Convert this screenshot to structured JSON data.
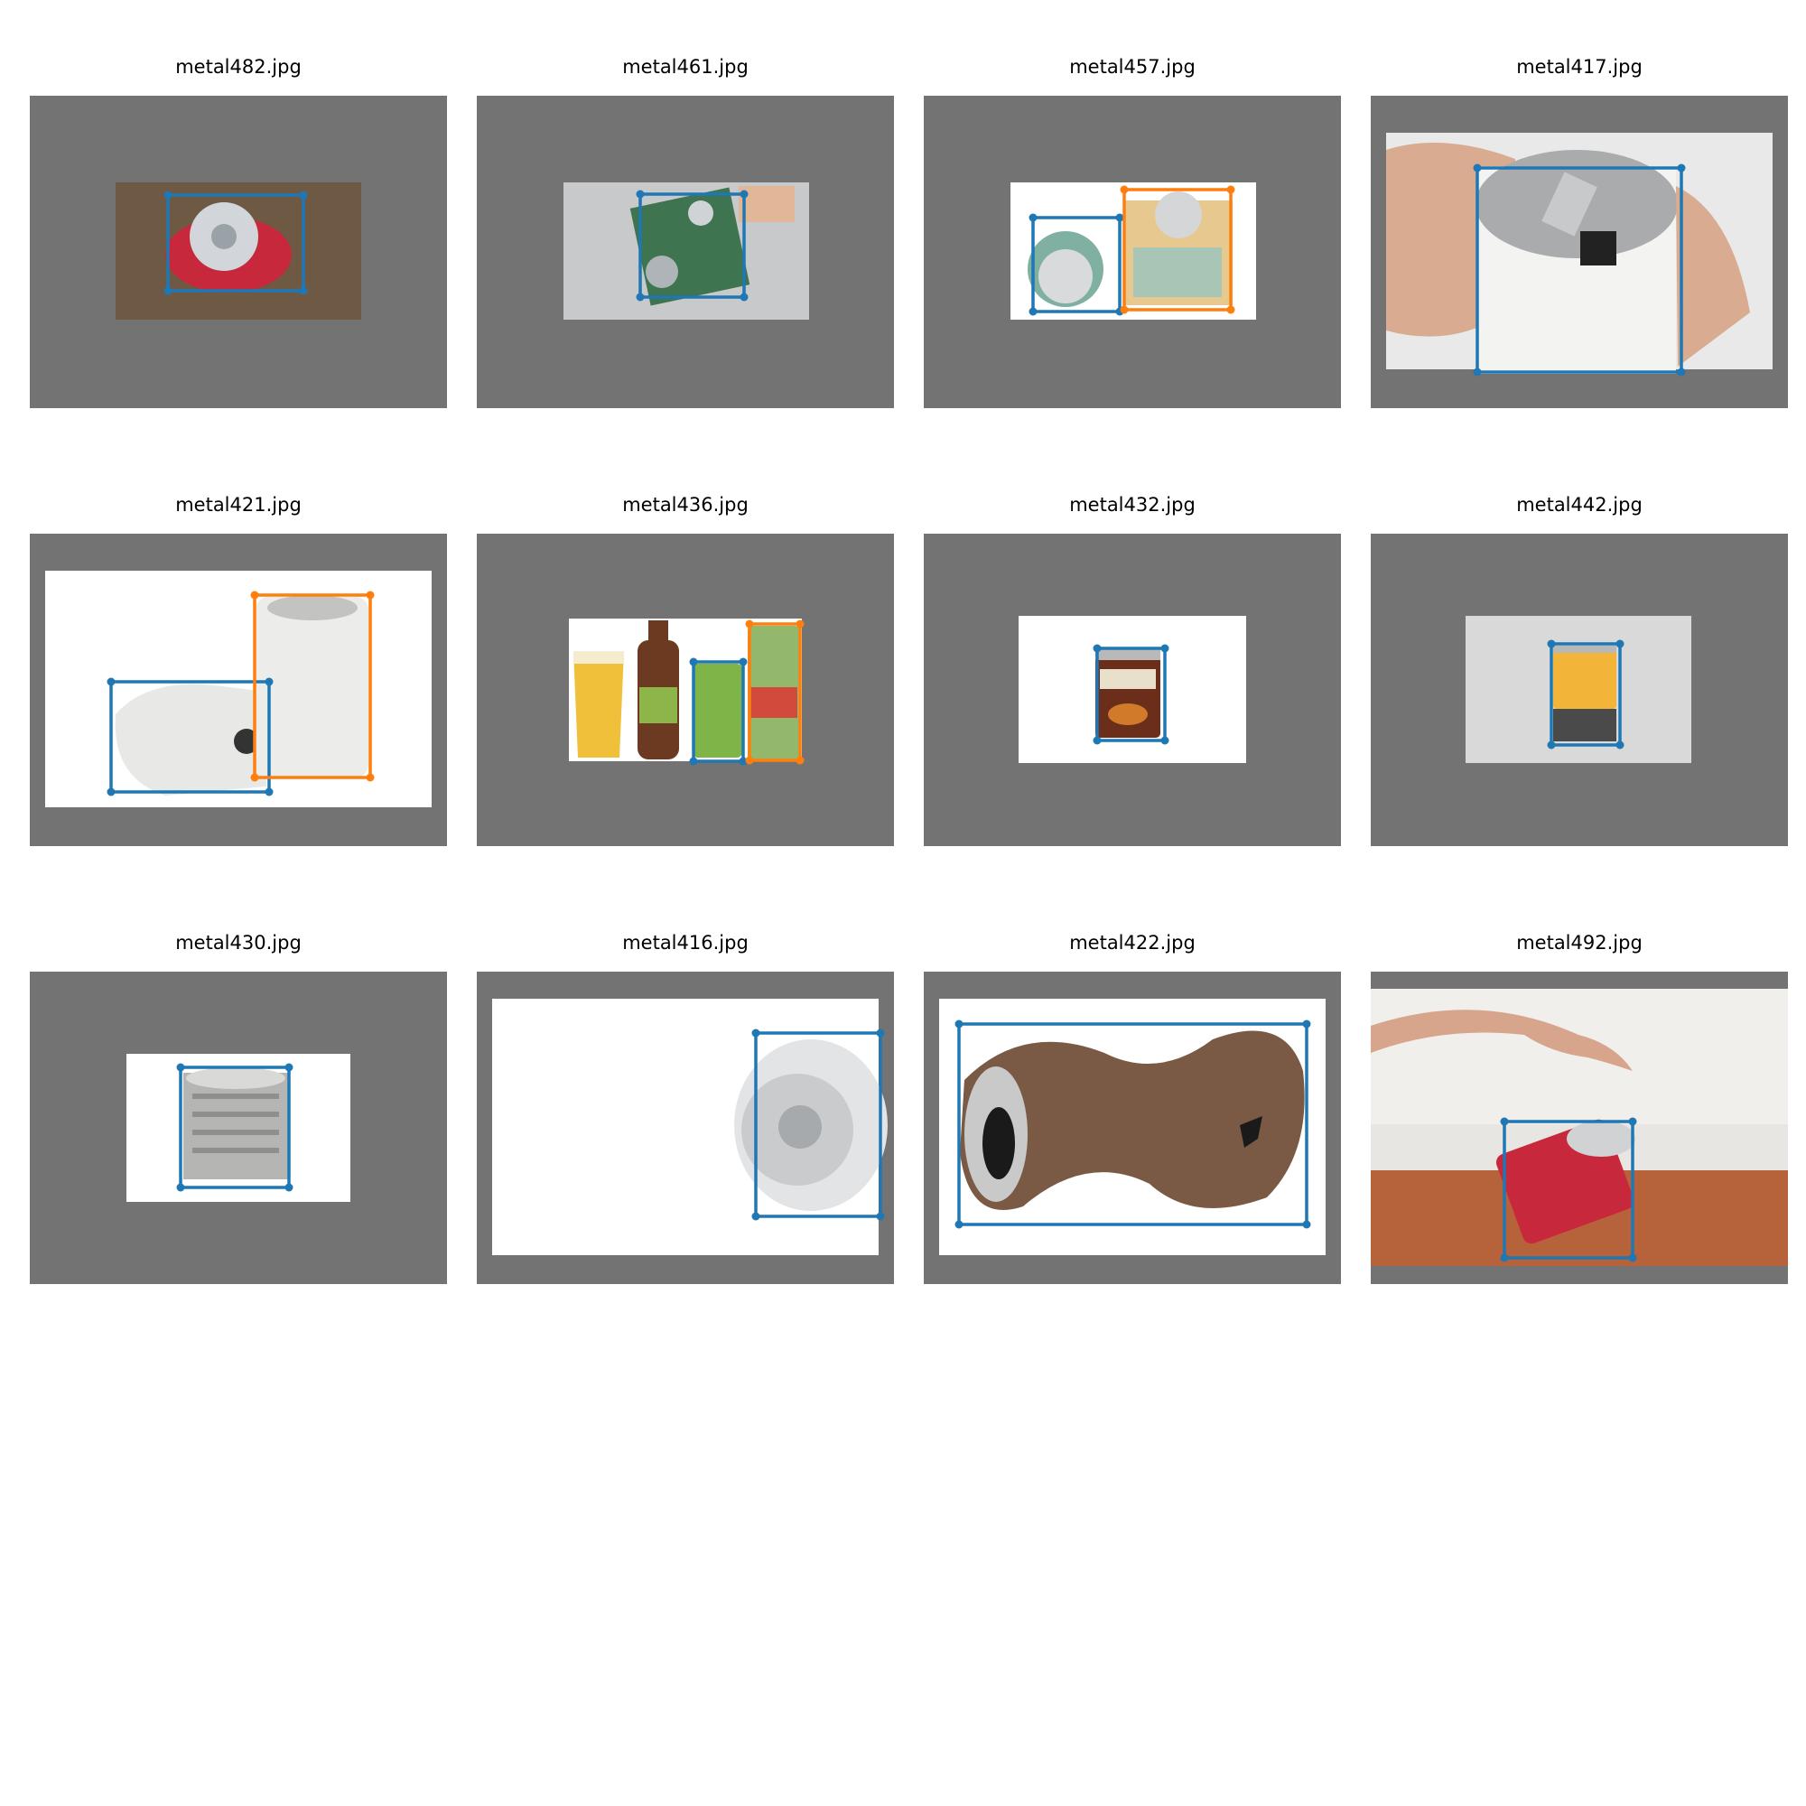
{
  "grid": {
    "tiles": [
      {
        "filename": "metal482.jpg"
      },
      {
        "filename": "metal461.jpg"
      },
      {
        "filename": "metal457.jpg"
      },
      {
        "filename": "metal417.jpg"
      },
      {
        "filename": "metal421.jpg"
      },
      {
        "filename": "metal436.jpg"
      },
      {
        "filename": "metal432.jpg"
      },
      {
        "filename": "metal442.jpg"
      },
      {
        "filename": "metal430.jpg"
      },
      {
        "filename": "metal416.jpg"
      },
      {
        "filename": "metal422.jpg"
      },
      {
        "filename": "metal492.jpg"
      }
    ]
  },
  "colors": {
    "panel_background": "#737373",
    "bbox_primary": "#1f77b4",
    "bbox_secondary": "#ff7f0e"
  }
}
